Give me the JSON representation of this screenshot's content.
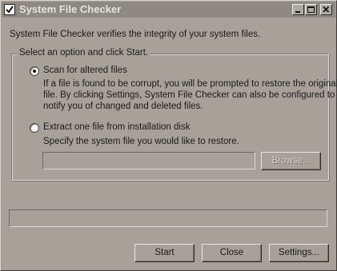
{
  "window": {
    "title": "System File Checker",
    "icon": "checkmark-document-icon",
    "controls": [
      "minimize-icon",
      "maximize-icon",
      "close-icon"
    ]
  },
  "intro_text": "System File Checker verifies the integrity of your system files.",
  "options_group": {
    "legend": "Select an option and click Start.",
    "scan_option": {
      "label": "Scan for altered files",
      "selected": true,
      "description_lines": [
        "If a file is found to be corrupt, you will be prompted to restore the original",
        "file. By clicking Settings, System File Checker can also be configured to",
        "notify you of changed and deleted files."
      ]
    },
    "extract_option": {
      "label": "Extract one file from installation disk",
      "selected": false,
      "description": "Specify the system file you would like to restore.",
      "file_value": "",
      "browse_label": "Browse..."
    }
  },
  "progress": {
    "value": 0
  },
  "buttons": {
    "start": "Start",
    "close": "Close",
    "settings": "Settings..."
  }
}
